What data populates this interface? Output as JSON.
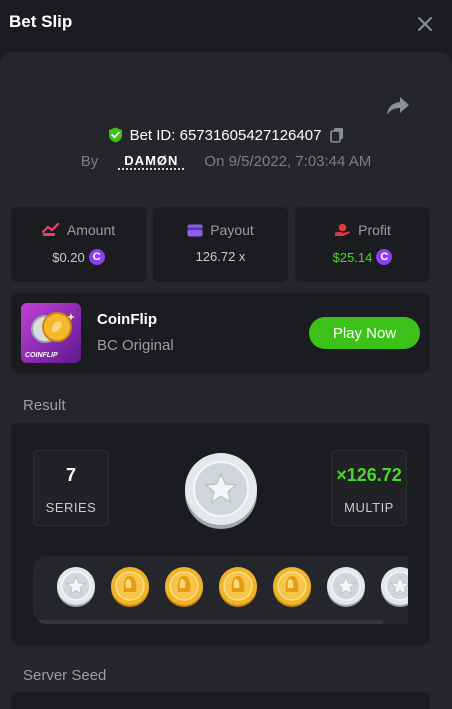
{
  "header": {
    "title": "Bet Slip"
  },
  "bet": {
    "id_text": "Bet ID: 65731605427126407",
    "by_label": "By",
    "username": "DAMØN",
    "on_label": "On",
    "date": "9/5/2022, 7:03:44 AM"
  },
  "stats": {
    "amount": {
      "label": "Amount",
      "value": "$0.20",
      "currency_symbol": "C"
    },
    "payout": {
      "label": "Payout",
      "value": "126.72 x"
    },
    "profit": {
      "label": "Profit",
      "value": "$25.14",
      "currency_symbol": "C"
    }
  },
  "game": {
    "name": "CoinFlip",
    "subtitle": "BC Original",
    "thumb_label": "COINFLIP",
    "play_label": "Play Now"
  },
  "result": {
    "section_label": "Result",
    "series_value": "7",
    "series_label": "SERIES",
    "multiplier_value": "×126.72",
    "multiplier_label": "MULTIP",
    "flips": [
      "silver",
      "gold",
      "gold",
      "gold",
      "gold",
      "silver",
      "silver"
    ]
  },
  "server_seed": {
    "label": "Server Seed"
  },
  "colors": {
    "green": "#3bc117",
    "profit_green": "#4dd72a",
    "gold": "#f0b429",
    "silver": "#d0d6da",
    "currency_purple": "#8d3df2"
  },
  "icons": {
    "close": "close-icon",
    "share": "share-icon",
    "verified": "shield-check-icon",
    "copy": "copy-icon",
    "amount": "amount-icon",
    "payout": "card-icon",
    "profit": "profit-icon"
  }
}
